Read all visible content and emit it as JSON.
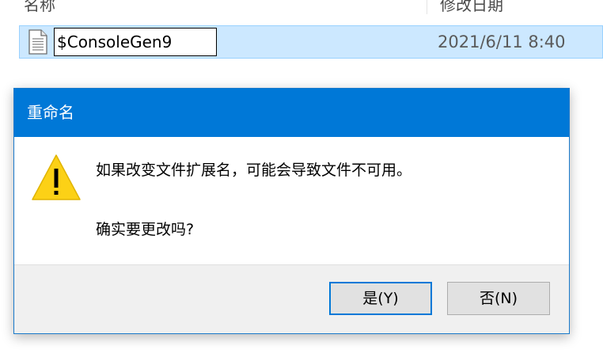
{
  "explorer": {
    "header": {
      "name_col": "名称",
      "date_col": "修改日期"
    },
    "selected_file": {
      "rename_value": "$ConsoleGen9",
      "date": "2021/6/11 8:40"
    }
  },
  "dialog": {
    "title": "重命名",
    "message_line1": "如果改变文件扩展名，可能会导致文件不可用。",
    "message_line2": "确实要更改吗?",
    "yes_label": "是(Y)",
    "no_label": "否(N)"
  },
  "colors": {
    "titlebar": "#0078d7",
    "selection": "#cce8ff",
    "warning": "#fcd116"
  },
  "icons": {
    "file": "document-icon",
    "warning": "warning-icon"
  }
}
